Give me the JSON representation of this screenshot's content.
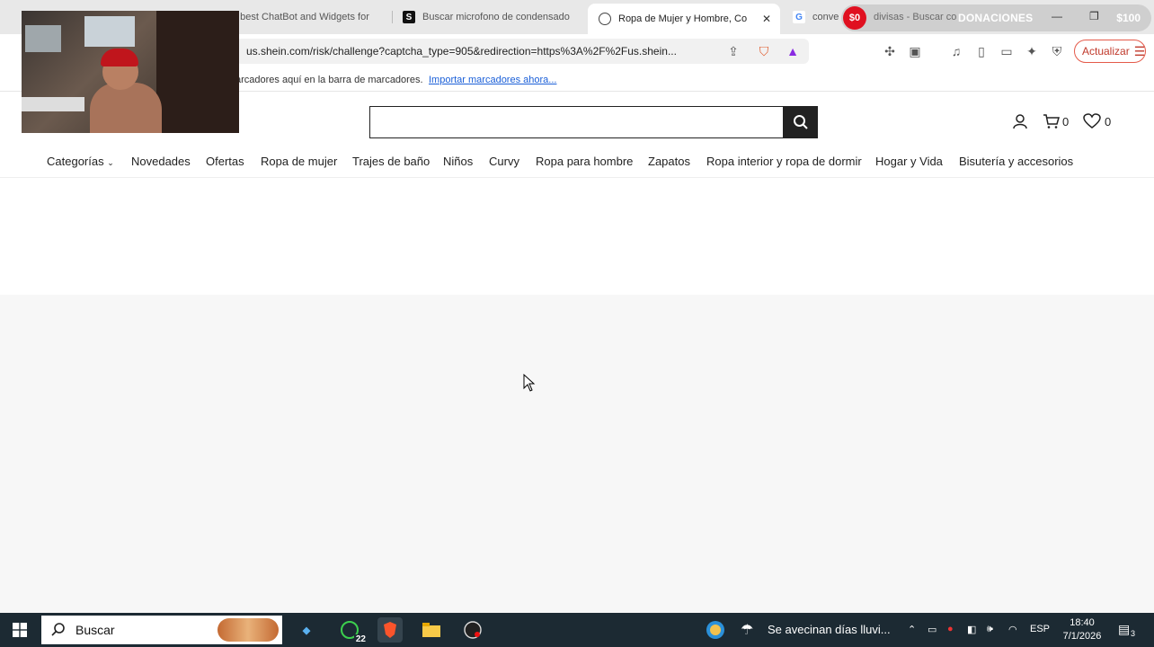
{
  "browser": {
    "tabs": [
      {
        "title": "e best ChatBot and Widgets for",
        "icon": "page-icon",
        "active": false
      },
      {
        "title": "Buscar microfono de condensado",
        "icon": "s-favicon-icon",
        "active": false
      },
      {
        "title": "Ropa de Mujer y Hombre, Co",
        "icon": "shein-favicon-icon",
        "active": true
      },
      {
        "title": "conve",
        "icon": "google-favicon-icon",
        "active": false
      }
    ],
    "tab_close": "✕",
    "url": "us.shein.com/risk/challenge?captcha_type=905&redirection=https%3A%2F%2Fus.shein...",
    "update_label": "Actualizar",
    "bookmarks_message": "arcadores aquí en la barra de marcadores.",
    "bookmarks_link": "Importar marcadores ahora..."
  },
  "donation_widget": {
    "amount": "$0",
    "title": "DONACIONES",
    "goal": "$100",
    "background_text": "divisas - Buscar co"
  },
  "site": {
    "search_placeholder": "",
    "account_count_cart": "0",
    "wishlist_count": "0",
    "nav": [
      "Categorías",
      "Novedades",
      "Ofertas",
      "Ropa de mujer",
      "Trajes de baño",
      "Niños",
      "Curvy",
      "Ropa para hombre",
      "Zapatos",
      "Ropa interior y ropa de dormir",
      "Hogar y Vida",
      "Bisutería y accesorios"
    ]
  },
  "taskbar": {
    "search_placeholder": "Buscar",
    "whatsapp_badge": "22",
    "weather_text": "Se avecinan días lluvi...",
    "language": "ESP",
    "time": "18:40",
    "date": "7/1/2026",
    "notifications": "3"
  },
  "colors": {
    "accent_red": "#c0392b",
    "taskbar_bg": "#1c2a33",
    "search_button": "#222222"
  }
}
